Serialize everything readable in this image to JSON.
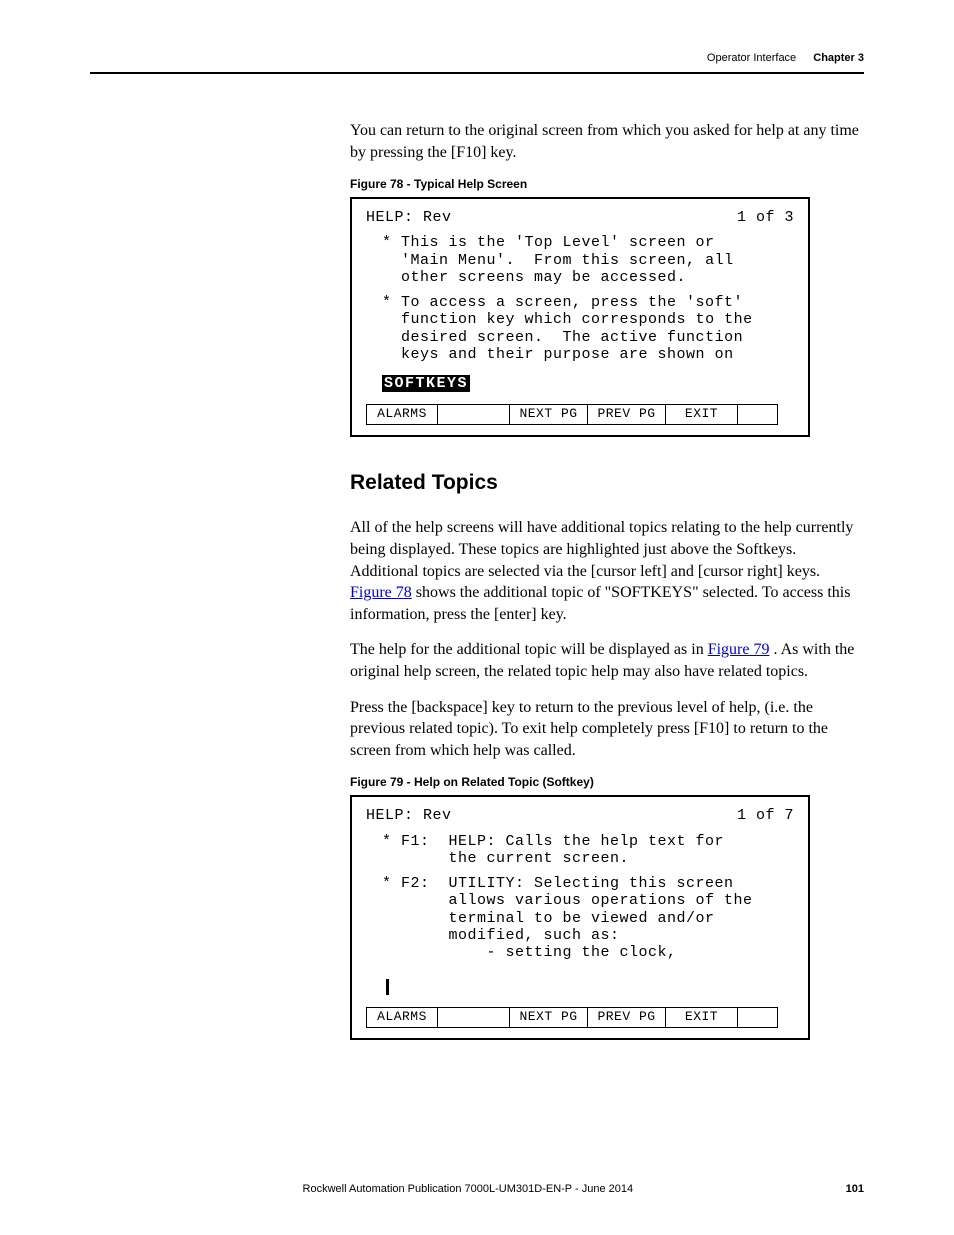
{
  "header": {
    "section": "Operator Interface",
    "chapter": "Chapter 3"
  },
  "intro": "You can return to the original screen from which you asked for help at any time by pressing the [F10] key.",
  "fig78": {
    "caption": "Figure 78 - Typical Help Screen",
    "title": "HELP: Rev",
    "page": "1 of  3",
    "block1": "* This is the 'Top Level' screen or\n  'Main Menu'.  From this screen, all\n  other screens may be accessed.",
    "block2": "* To access a screen, press the 'soft'\n  function key which corresponds to the\n  desired screen.  The active function\n  keys and their purpose are shown on",
    "highlight": "SOFTKEYS",
    "softkeys": {
      "alarms": "ALARMS",
      "next": "NEXT PG",
      "prev": "PREV PG",
      "exit": "EXIT"
    }
  },
  "related": {
    "heading": "Related Topics",
    "p1a": "All of the help screens will have additional topics relating to the help currently being displayed. These topics are highlighted just above the Softkeys. Additional topics are selected via the [cursor left] and [cursor right] keys. ",
    "p1link": "Figure 78",
    "p1b": " shows the additional topic of \"SOFTKEYS\" selected. To access this information, press the [enter] key.",
    "p2a": "The help for the additional topic will be displayed as in ",
    "p2link": "Figure 79",
    "p2b": " . As with the original help screen, the related topic help may also have related topics.",
    "p3": "Press the [backspace] key to return to the previous level of help, (i.e. the previous related topic). To exit help completely press [F10] to return to the screen from which help was called."
  },
  "fig79": {
    "caption": "Figure 79 - Help on Related Topic (Softkey)",
    "title": "HELP: Rev",
    "page": "1 of  7",
    "block1": "* F1:  HELP: Calls the help text for\n       the current screen.",
    "block2": "* F2:  UTILITY: Selecting this screen\n       allows various operations of the\n       terminal to be viewed and/or\n       modified, such as:\n           - setting the clock,",
    "softkeys": {
      "alarms": "ALARMS",
      "next": "NEXT PG",
      "prev": "PREV PG",
      "exit": "EXIT"
    }
  },
  "footer": {
    "pub": "Rockwell Automation Publication 7000L-UM301D-EN-P - June 2014",
    "page": "101"
  },
  "chart_data": null
}
